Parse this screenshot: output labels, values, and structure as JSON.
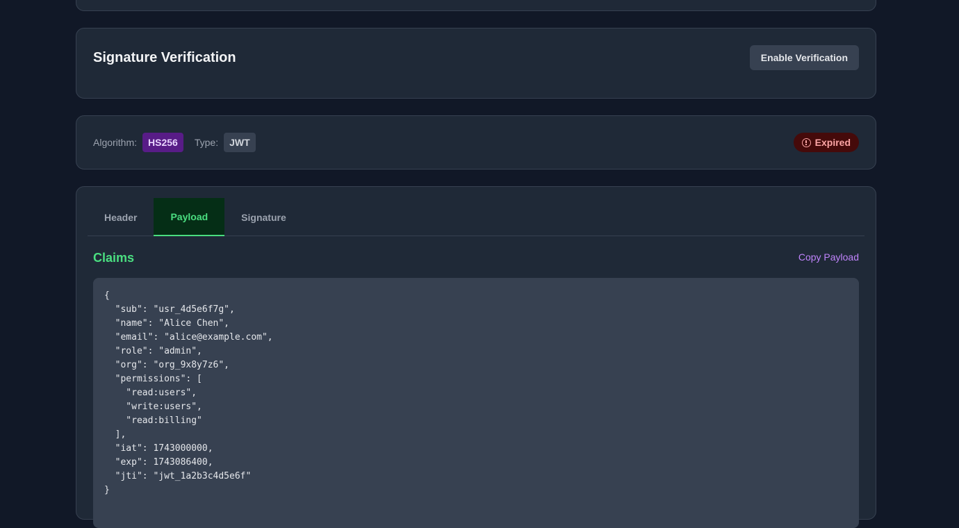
{
  "verification": {
    "title": "Signature Verification",
    "enable_button": "Enable Verification"
  },
  "meta": {
    "algorithm_label": "Algorithm:",
    "algorithm_value": "HS256",
    "type_label": "Type:",
    "type_value": "JWT",
    "status": "Expired",
    "status_icon": "alert-circle-icon",
    "status_color": "#fca5a5"
  },
  "tabs": [
    {
      "label": "Header",
      "active": false
    },
    {
      "label": "Payload",
      "active": true
    },
    {
      "label": "Signature",
      "active": false
    }
  ],
  "claims": {
    "title": "Claims",
    "copy_label": "Copy Payload",
    "payload": "{\n  \"sub\": \"usr_4d5e6f7g\",\n  \"name\": \"Alice Chen\",\n  \"email\": \"alice@example.com\",\n  \"role\": \"admin\",\n  \"org\": \"org_9x8y7z6\",\n  \"permissions\": [\n    \"read:users\",\n    \"write:users\",\n    \"read:billing\"\n  ],\n  \"iat\": 1743000000,\n  \"exp\": 1743086400,\n  \"jti\": \"jwt_1a2b3c4d5e6f\"\n}"
  },
  "colors": {
    "background": "#111827",
    "card": "#1f2937",
    "accent_green": "#4ade80",
    "accent_purple": "#c084fc",
    "algorithm_badge": "#581c87",
    "expired_badge": "#450a0a"
  }
}
